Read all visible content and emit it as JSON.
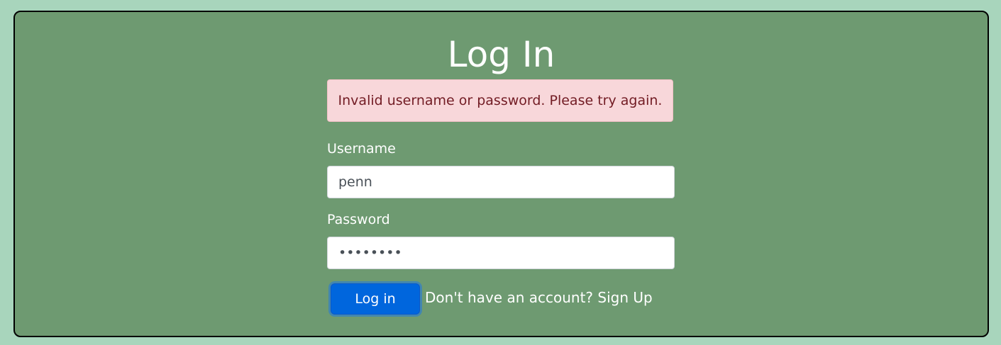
{
  "page": {
    "title": "Log In"
  },
  "alert": {
    "message": "Invalid username or password. Please try again."
  },
  "form": {
    "username_label": "Username",
    "username_value": "penn",
    "password_label": "Password",
    "password_value": "••••••••",
    "submit_label": "Log in"
  },
  "signup": {
    "prompt": "Don't have an account? ",
    "link": "Sign Up"
  },
  "colors": {
    "page_background": "#a8d5bc",
    "card_background": "#6e9a71",
    "alert_background": "#f8d7da",
    "alert_text": "#721c24",
    "primary_button": "#0066dd"
  }
}
